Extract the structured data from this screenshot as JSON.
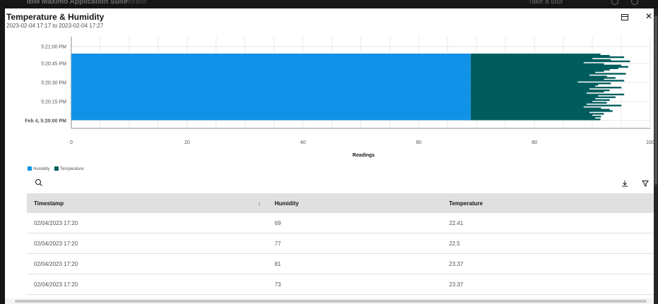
{
  "app": {
    "brand": "IBM Maximo Application Suite",
    "crumb": "Monitor",
    "tour_label": "Take a tour"
  },
  "modal": {
    "title": "Temperature & Humidity",
    "subtitle": "2023-02-04 17:17 to 2023-02-04 17:27",
    "icons": [
      "calendar-icon",
      "close-icon"
    ]
  },
  "colors": {
    "humidity": "#1192e8",
    "temperature": "#005d5d"
  },
  "chart_data": {
    "type": "bar",
    "orientation": "horizontal",
    "stacked": true,
    "xlabel": "Readings",
    "ylabel": "",
    "xlim": [
      0,
      100
    ],
    "x_ticks": [
      "0",
      "20",
      "40",
      "60",
      "80",
      "100"
    ],
    "y_ticks": [
      "5:21:00 PM",
      "5:20:45 PM",
      "5:20:30 PM",
      "5:20:15 PM",
      "Feb 4, 5:20:00 PM"
    ],
    "grid": true,
    "legend": "bottom-left",
    "series": [
      {
        "name": "Humidity",
        "values": [
          69,
          69,
          69,
          69,
          69,
          69,
          69,
          69,
          69,
          69,
          69,
          69,
          69,
          69,
          69,
          69,
          69,
          69,
          69,
          69,
          69,
          69,
          69,
          69,
          69,
          69,
          69,
          69,
          69,
          69,
          69,
          69,
          69,
          69,
          69,
          69,
          69,
          69,
          69,
          69,
          69,
          69,
          69,
          69,
          69,
          69,
          69,
          69
        ]
      },
      {
        "name": "Temperature",
        "values": [
          22.4,
          24.0,
          26.5,
          21.0,
          24.2,
          27.5,
          19.5,
          23.0,
          26.0,
          27.2,
          25.5,
          24.0,
          23.0,
          21.5,
          26.8,
          20.5,
          23.5,
          25.0,
          23.0,
          26.5,
          18.5,
          24.2,
          22.0,
          21.5,
          26.0,
          20.5,
          24.0,
          23.0,
          20.0,
          26.5,
          22.0,
          25.0,
          21.5,
          24.0,
          21.0,
          23.5,
          20.0,
          26.0,
          19.5,
          22.5,
          24.0,
          24.5,
          20.5,
          23.0,
          21.0,
          22.5,
          21.5,
          22.4
        ]
      }
    ]
  },
  "legend_items": [
    {
      "label": "Humidity",
      "color": "#1192e8"
    },
    {
      "label": "Temperature",
      "color": "#005d5d"
    }
  ],
  "table": {
    "columns": [
      "Timestamp",
      "Humidity",
      "Temperature"
    ],
    "sort_column": "Timestamp",
    "rows": [
      [
        "02/04/2023 17:20",
        "69",
        "22.41"
      ],
      [
        "02/04/2023 17:20",
        "77",
        "22.5"
      ],
      [
        "02/04/2023 17:20",
        "81",
        "23.37"
      ],
      [
        "02/04/2023 17:20",
        "73",
        "23.37"
      ]
    ]
  }
}
